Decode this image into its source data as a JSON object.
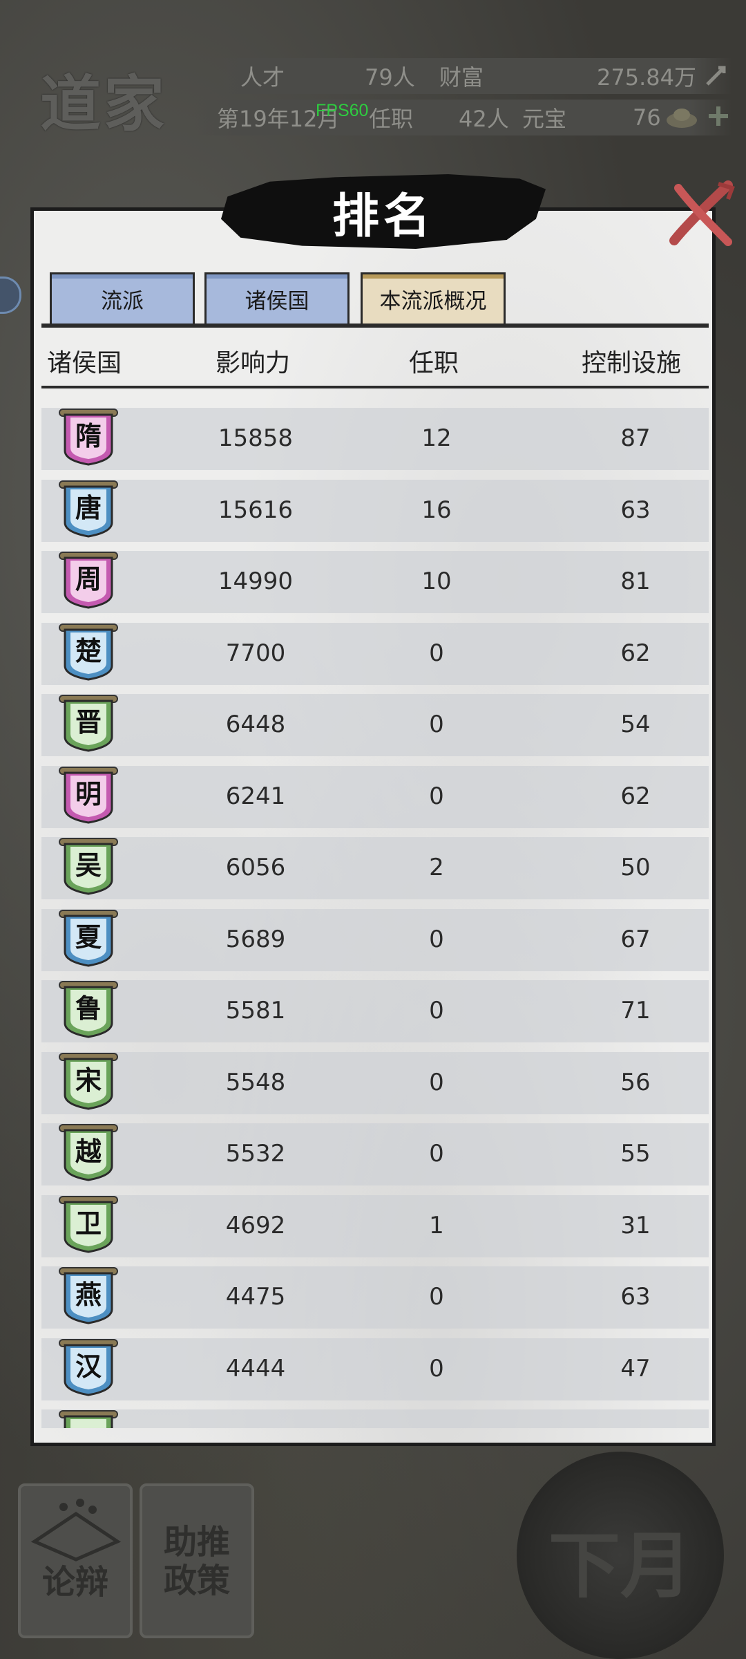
{
  "hud": {
    "sect_title": "道家",
    "talent_label": "人才",
    "talent_value": "79人",
    "wealth_label": "财富",
    "wealth_value": "275.84万",
    "date": "第19年12月",
    "fps": "FPS60",
    "office_label": "任职",
    "office_value": "42人",
    "yuanbao_label": "元宝",
    "yuanbao_value": "76"
  },
  "panel": {
    "title": "排名",
    "tabs": [
      {
        "label": "流派",
        "active": false
      },
      {
        "label": "诸侯国",
        "active": false
      },
      {
        "label": "本流派概况",
        "active": true
      }
    ],
    "columns": [
      "诸侯国",
      "影响力",
      "任职",
      "控制设施"
    ]
  },
  "rows": [
    {
      "state": "隋",
      "badge": "pink",
      "influence": "15858",
      "office": "12",
      "facilities": "87"
    },
    {
      "state": "唐",
      "badge": "blue",
      "influence": "15616",
      "office": "16",
      "facilities": "63"
    },
    {
      "state": "周",
      "badge": "pink",
      "influence": "14990",
      "office": "10",
      "facilities": "81"
    },
    {
      "state": "楚",
      "badge": "blue",
      "influence": "7700",
      "office": "0",
      "facilities": "62"
    },
    {
      "state": "晋",
      "badge": "green",
      "influence": "6448",
      "office": "0",
      "facilities": "54"
    },
    {
      "state": "明",
      "badge": "pink",
      "influence": "6241",
      "office": "0",
      "facilities": "62"
    },
    {
      "state": "吴",
      "badge": "green",
      "influence": "6056",
      "office": "2",
      "facilities": "50"
    },
    {
      "state": "夏",
      "badge": "blue",
      "influence": "5689",
      "office": "0",
      "facilities": "67"
    },
    {
      "state": "鲁",
      "badge": "green",
      "influence": "5581",
      "office": "0",
      "facilities": "71"
    },
    {
      "state": "宋",
      "badge": "green",
      "influence": "5548",
      "office": "0",
      "facilities": "56"
    },
    {
      "state": "越",
      "badge": "green",
      "influence": "5532",
      "office": "0",
      "facilities": "55"
    },
    {
      "state": "卫",
      "badge": "green",
      "influence": "4692",
      "office": "1",
      "facilities": "31"
    },
    {
      "state": "燕",
      "badge": "blue",
      "influence": "4475",
      "office": "0",
      "facilities": "63"
    },
    {
      "state": "汉",
      "badge": "blue",
      "influence": "4444",
      "office": "0",
      "facilities": "47"
    },
    {
      "state": "",
      "badge": "green",
      "influence": "",
      "office": "",
      "facilities": ""
    }
  ],
  "badge_colors": {
    "pink": {
      "fill": "#f3cdea",
      "ring": "#c45ab0"
    },
    "blue": {
      "fill": "#d3e8f6",
      "ring": "#4d8fc2"
    },
    "green": {
      "fill": "#dbefd3",
      "ring": "#6aa35a"
    }
  },
  "bottom": {
    "debate_label_1": "论",
    "debate_label_2": "辩",
    "policy_label_1": "助推",
    "policy_label_2": "政策",
    "next_month_label": "下月"
  }
}
